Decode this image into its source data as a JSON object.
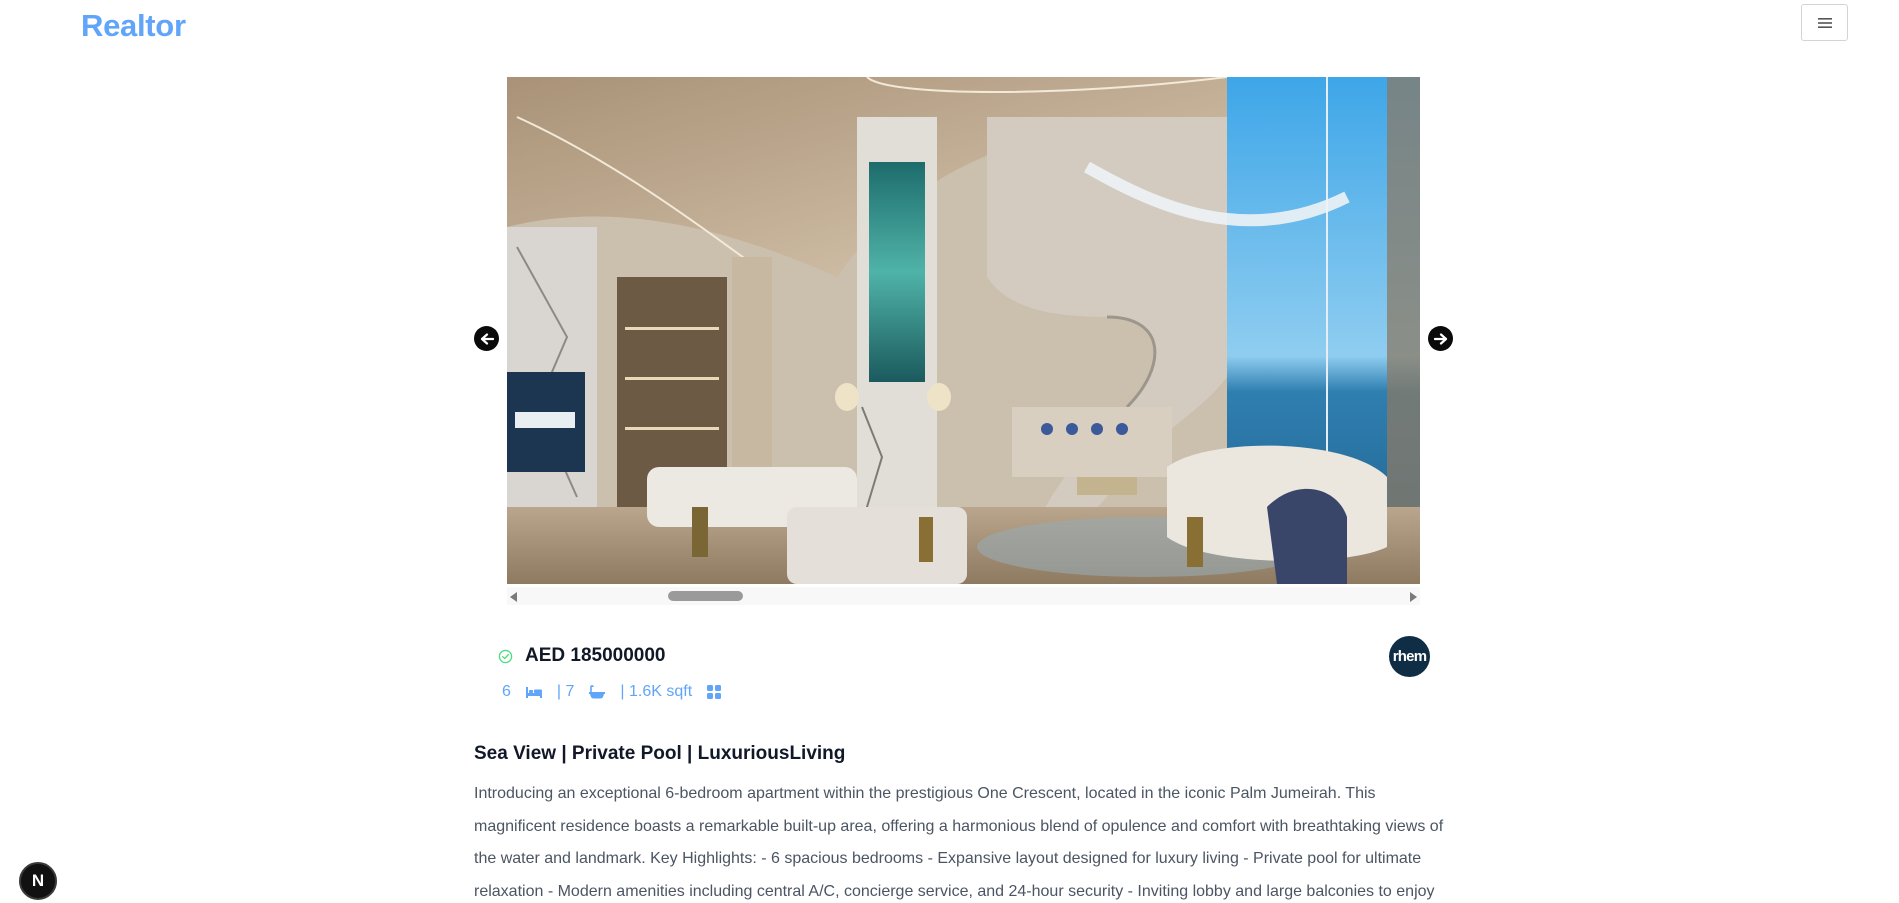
{
  "header": {
    "brand": "Realtor",
    "menu_icon": "hamburger-icon"
  },
  "gallery": {
    "image_alt": "Luxury living room interior with spiral staircase and sea view",
    "prev_icon": "arrow-left-icon",
    "next_icon": "arrow-right-icon"
  },
  "listing": {
    "verified_icon": "check-circle-icon",
    "price": "AED 185000000",
    "agency_logo_text": "rhem",
    "bedrooms": "6",
    "bed_icon": "bed-icon",
    "bathrooms": "| 7",
    "bath_icon": "bathtub-icon",
    "area": "| 1.6K sqft",
    "area_icon": "grid-icon",
    "title": "Sea View | Private Pool | LuxuriousLiving",
    "description": "Introducing an exceptional 6-bedroom apartment within the prestigious One Crescent, located in the iconic Palm Jumeirah. This magnificent residence boasts a remarkable built-up area, offering a harmonious blend of opulence and comfort with breathtaking views of the water and landmark. Key Highlights: - 6 spacious bedrooms - Expansive layout designed for luxury living - Private pool for ultimate relaxation - Modern amenities including central A/C, concierge service, and 24-hour security - Inviting lobby and large balconies to enjoy"
  },
  "devtools": {
    "badge_letter": "N"
  },
  "colors": {
    "accent": "#60a5fa",
    "check": "#4ade80",
    "agency_bg": "#0f2d44"
  }
}
